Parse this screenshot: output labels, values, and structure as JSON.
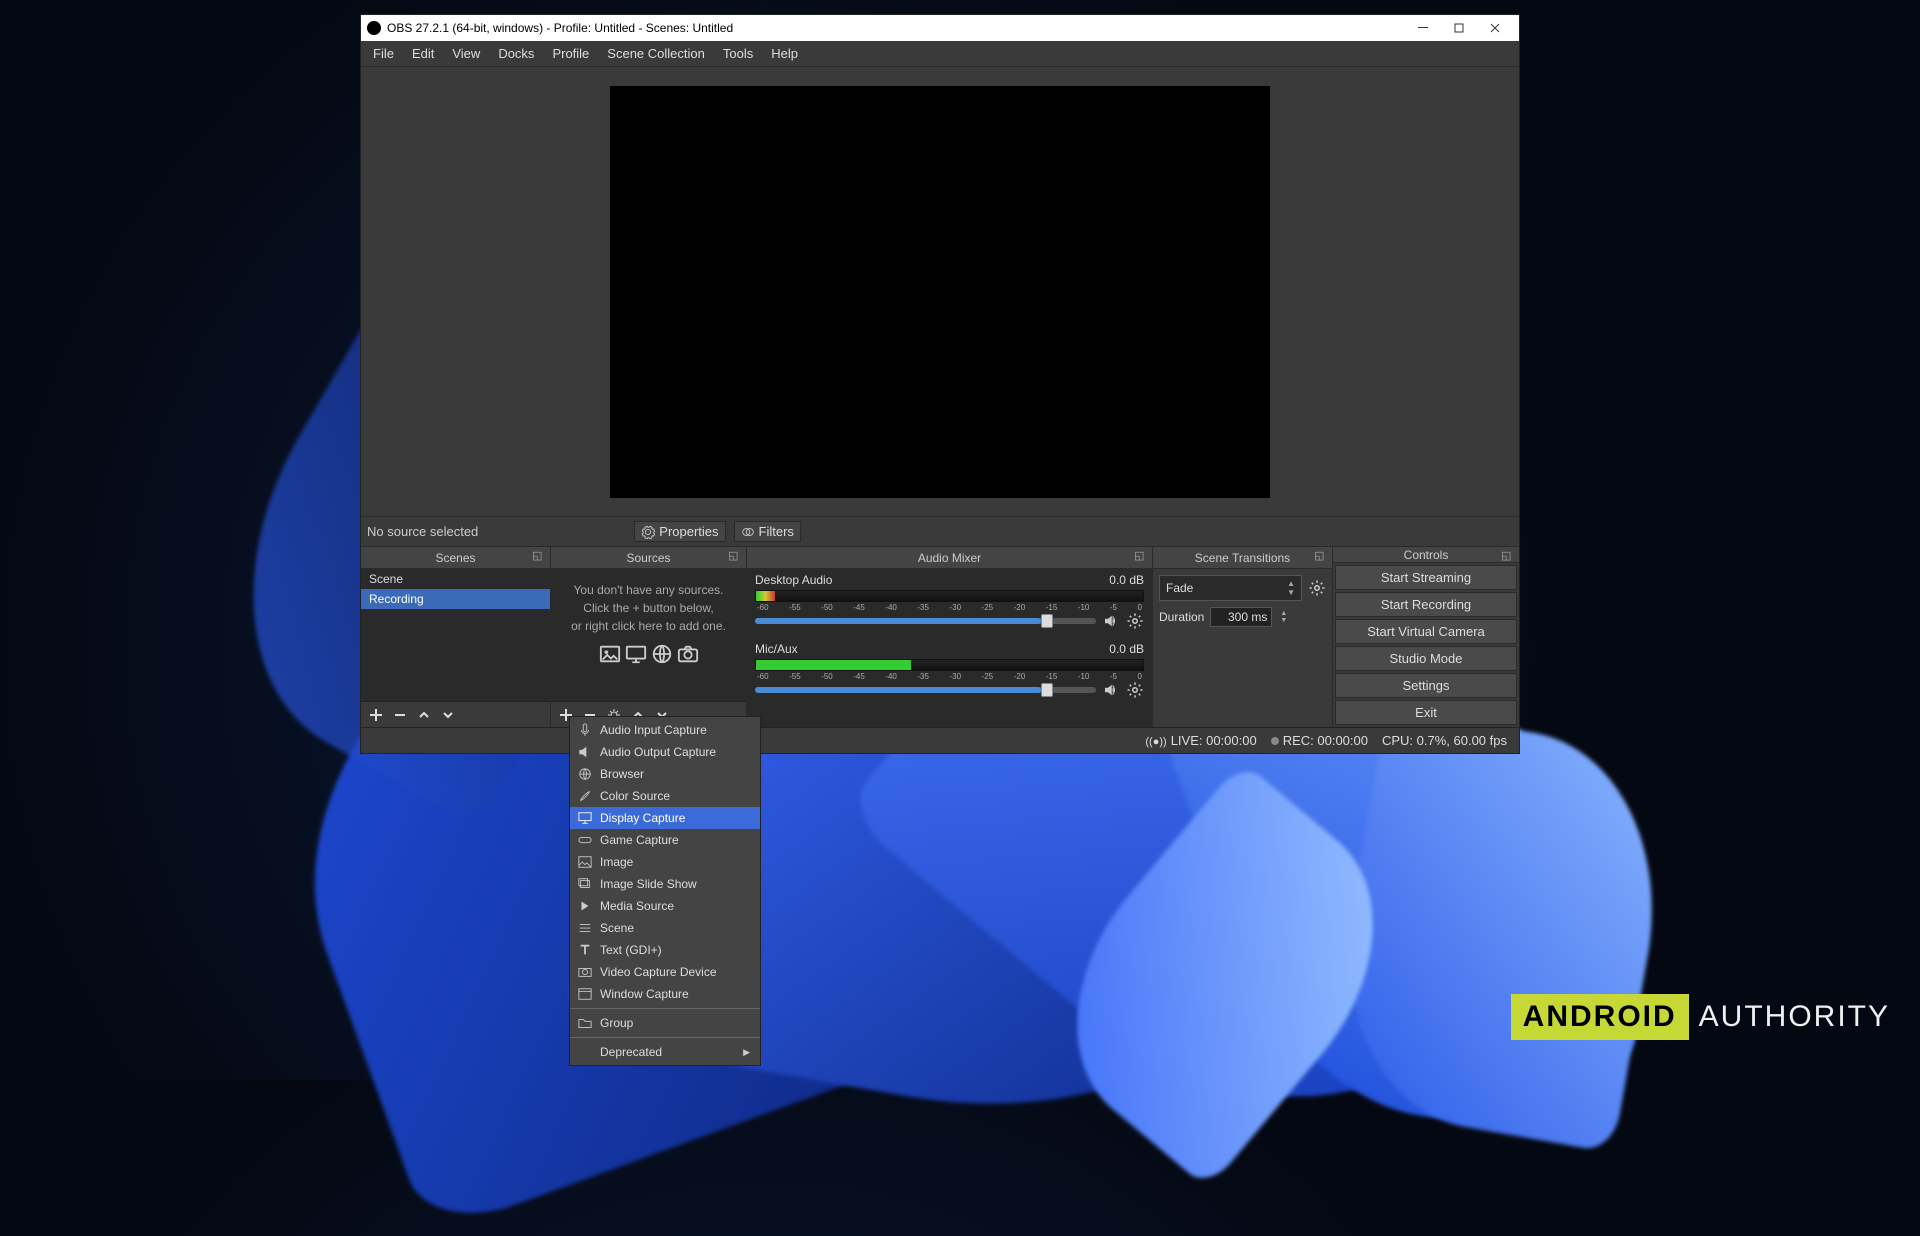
{
  "window": {
    "title": "OBS 27.2.1 (64-bit, windows) - Profile: Untitled - Scenes: Untitled"
  },
  "menubar": [
    "File",
    "Edit",
    "View",
    "Docks",
    "Profile",
    "Scene Collection",
    "Tools",
    "Help"
  ],
  "status_row": {
    "no_source": "No source selected",
    "properties": "Properties",
    "filters": "Filters"
  },
  "docks": {
    "scenes": {
      "title": "Scenes",
      "items": [
        "Scene",
        "Recording"
      ],
      "selected": 1
    },
    "sources": {
      "title": "Sources",
      "empty_lines": [
        "You don't have any sources.",
        "Click the + button below,",
        "or right click here to add one."
      ]
    },
    "mixer": {
      "title": "Audio Mixer",
      "channels": [
        {
          "name": "Desktop Audio",
          "db": "0.0 dB",
          "level": 0.05
        },
        {
          "name": "Mic/Aux",
          "db": "0.0 dB",
          "level": 0.4
        }
      ],
      "ticks": [
        "-60",
        "-55",
        "-50",
        "-45",
        "-40",
        "-35",
        "-30",
        "-25",
        "-20",
        "-15",
        "-10",
        "-5",
        "0"
      ]
    },
    "transitions": {
      "title": "Scene Transitions",
      "selected": "Fade",
      "duration_label": "Duration",
      "duration_value": "300 ms"
    },
    "controls": {
      "title": "Controls",
      "buttons": [
        "Start Streaming",
        "Start Recording",
        "Start Virtual Camera",
        "Studio Mode",
        "Settings",
        "Exit"
      ]
    }
  },
  "statusbar": {
    "live": "LIVE: 00:00:00",
    "rec": "REC: 00:00:00",
    "cpu": "CPU: 0.7%, 60.00 fps"
  },
  "ctxmenu": {
    "items": [
      "Audio Input Capture",
      "Audio Output Capture",
      "Browser",
      "Color Source",
      "Display Capture",
      "Game Capture",
      "Image",
      "Image Slide Show",
      "Media Source",
      "Scene",
      "Text (GDI+)",
      "Video Capture Device",
      "Window Capture"
    ],
    "group": "Group",
    "deprecated": "Deprecated",
    "highlighted": 4
  },
  "watermark": {
    "brand": "ANDROID",
    "word": "AUTHORITY"
  }
}
